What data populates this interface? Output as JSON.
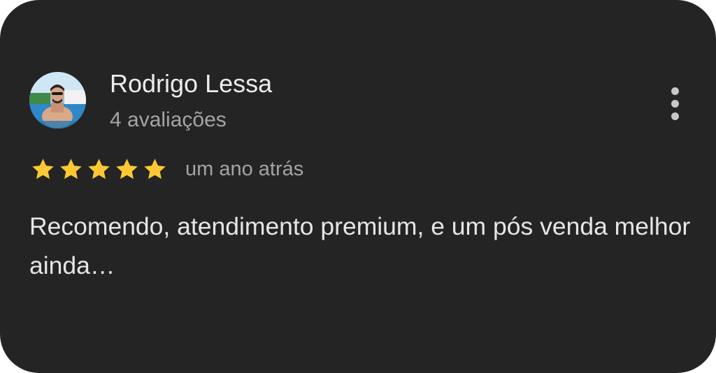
{
  "review": {
    "reviewer_name": "Rodrigo Lessa",
    "reviews_count": "4 avaliações",
    "rating": 5,
    "rating_max": 5,
    "time_ago": "um ano atrás",
    "text": "Recomendo, atendimento premium, e um pós venda melhor ainda…"
  },
  "icons": {
    "avatar": "profile-photo",
    "menu": "more-vert-icon",
    "star": "star-icon"
  },
  "colors": {
    "card_background": "#242424",
    "star": "#fcc934",
    "primary_text": "#ececec",
    "secondary_text": "#a4a4a4"
  }
}
